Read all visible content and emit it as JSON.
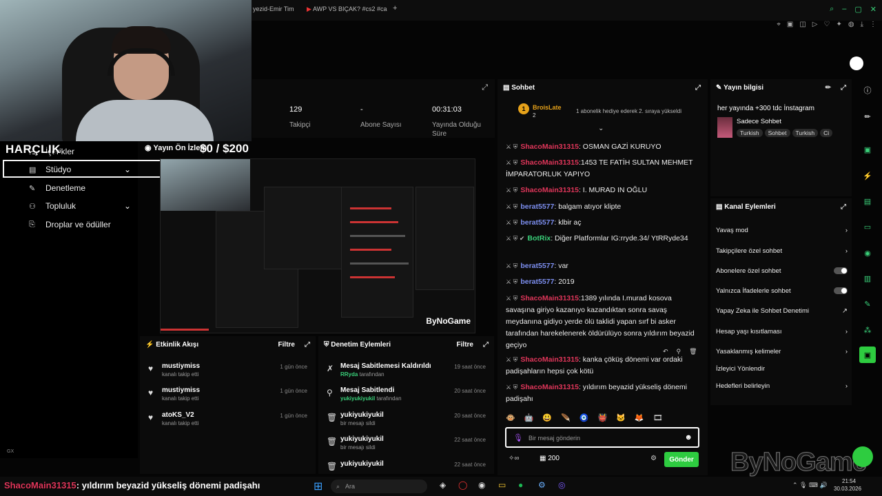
{
  "browser": {
    "tabs": [
      "yezid-Emir Tim",
      "AWP VS BIÇAK? #cs2 #ca",
      "+"
    ]
  },
  "overlay": {
    "harclik": "HARÇLIK",
    "preview_label": "Yayın Ön İzlem",
    "price": "$0  / $200",
    "caption_user": "ShacoMain31315",
    "caption_text": ": yıldırım beyazid yükseliş dönemi padişahı",
    "watermark": "ByNoGame"
  },
  "leftnav": {
    "items": [
      {
        "label": "İçerikler",
        "icon": "list-icon"
      },
      {
        "label": "Stüdyo",
        "icon": "studio-icon"
      },
      {
        "label": "Denetleme",
        "icon": "wrench-icon"
      },
      {
        "label": "Topluluk",
        "icon": "people-icon"
      },
      {
        "label": "Droplar ve ödüller",
        "icon": "gift-icon"
      }
    ]
  },
  "stats": [
    {
      "value": "129",
      "label": "Takipçi"
    },
    {
      "value": "-",
      "label": "Abone Sayısı"
    },
    {
      "value": "00:31:03",
      "label": "Yayında Olduğu Süre"
    }
  ],
  "event_feed": {
    "title": "Etkinlik Akışı",
    "filter": "Filtre",
    "rows": [
      {
        "name": "mustiymiss",
        "sub": "kanalı takip etti",
        "time": "1 gün önce"
      },
      {
        "name": "mustiymiss",
        "sub": "kanalı takip etti",
        "time": "1 gün önce"
      },
      {
        "name": "atoKS_V2",
        "sub": "kanalı takip etti",
        "time": "1 gün önce"
      }
    ]
  },
  "mod_actions": {
    "title": "Denetim Eylemleri",
    "filter": "Filtre",
    "rows": [
      {
        "name": "Mesaj Sabitlemesi Kaldırıldı",
        "sub_user": "RRyda",
        "sub": "tarafından",
        "time": "19 saat önce"
      },
      {
        "name": "Mesaj Sabitlendi",
        "sub_user": "yukiyukiyukil",
        "sub": "tarafından",
        "time": "20 saat önce"
      },
      {
        "name": "yukiyukiyukil",
        "sub_user": "",
        "sub": "bir mesajı sildi",
        "time": "20 saat önce"
      },
      {
        "name": "yukiyukiyukil",
        "sub_user": "",
        "sub": "bir mesajı sildi",
        "time": "22 saat önce"
      },
      {
        "name": "yukiyukiyukil",
        "sub_user": "",
        "sub": "",
        "time": "22 saat önce"
      }
    ]
  },
  "chat": {
    "title": "Sohbet",
    "pinned_user": "BroisLate",
    "pinned_count": "2",
    "pinned_text": "1 abonelik hediye ederek 2. sıraya yükseldi",
    "messages": [
      {
        "user": "ShacoMain31315",
        "text": ": OSMAN GAZİ KURUYO",
        "color": "red"
      },
      {
        "user": "ShacoMain31315",
        "text": ":1453 TE FATİH SULTAN MEHMET İMPARATORLUK YAPIYO",
        "color": "red"
      },
      {
        "user": "ShacoMain31315",
        "text": ": I. MURAD IN OĞLU",
        "color": "red"
      },
      {
        "user": "berat5577",
        "text": ": balgam atıyor klipte",
        "color": "blue"
      },
      {
        "user": "berat5577",
        "text": ": klbir aç",
        "color": "blue"
      },
      {
        "user": "BotRix",
        "text": ": Diğer Platformlar IG:rryde.34/ YtRRyde34",
        "color": "green"
      },
      {
        "user": "berat5577",
        "text": ": var",
        "color": "blue"
      },
      {
        "user": "berat5577",
        "text": ": 2019",
        "color": "blue"
      },
      {
        "user": "ShacoMain31315",
        "text": ":1389 yılında I.murad kosova savaşına giriyo kazanıyo kazandıktan sonra savaş meydanına gidiyo yerde ölü taklidi yapan sırf bi asker tarafından harekelenerek öldürülüyo sonra yıldırım beyazid geçiyo",
        "color": "red"
      },
      {
        "user": "ShacoMain31315",
        "text": ": kanka çöküş dönemi var ordaki padişahların hepsi çok kötü",
        "color": "red"
      },
      {
        "user": "ShacoMain31315",
        "text": ": yıldırım beyazid yükseliş dönemi padişahı",
        "color": "red"
      }
    ],
    "input_placeholder": "Bir mesaj gönderin",
    "points": "200",
    "send_label": "Gönder"
  },
  "stream_info": {
    "title": "Yayın bilgisi",
    "headline": "her yayında +300 tdc İnstagram",
    "category": "Sadece Sohbet",
    "tags": [
      "Turkish",
      "Sohbet",
      "Turkish",
      "Ci"
    ]
  },
  "channel_actions": {
    "title": "Kanal Eylemleri",
    "rows": [
      {
        "label": "Yavaş mod",
        "control": "chevron"
      },
      {
        "label": "Takipçilere özel sohbet",
        "control": "chevron"
      },
      {
        "label": "Abonelere özel sohbet",
        "control": "toggle"
      },
      {
        "label": "Yalnızca İfadelerle sohbet",
        "control": "toggle"
      },
      {
        "label": "Yapay Zeka ile Sohbet Denetimi",
        "control": "external"
      },
      {
        "label": "Hesap yaşı kısıtlaması",
        "control": "chevron"
      },
      {
        "label": "Yasaklanmış kelimeler",
        "control": "chevron"
      },
      {
        "label": "İzleyici Yönlendir",
        "control": "none"
      },
      {
        "label": "Hedefleri belirleyin",
        "control": "chevron"
      }
    ]
  },
  "taskbar": {
    "search": "Ara",
    "time": "21:54",
    "date": "30.03.2026"
  },
  "colors": {
    "accent": "#2ecc40",
    "mod_red": "#e0365a",
    "user_blue": "#7d8ff0"
  }
}
